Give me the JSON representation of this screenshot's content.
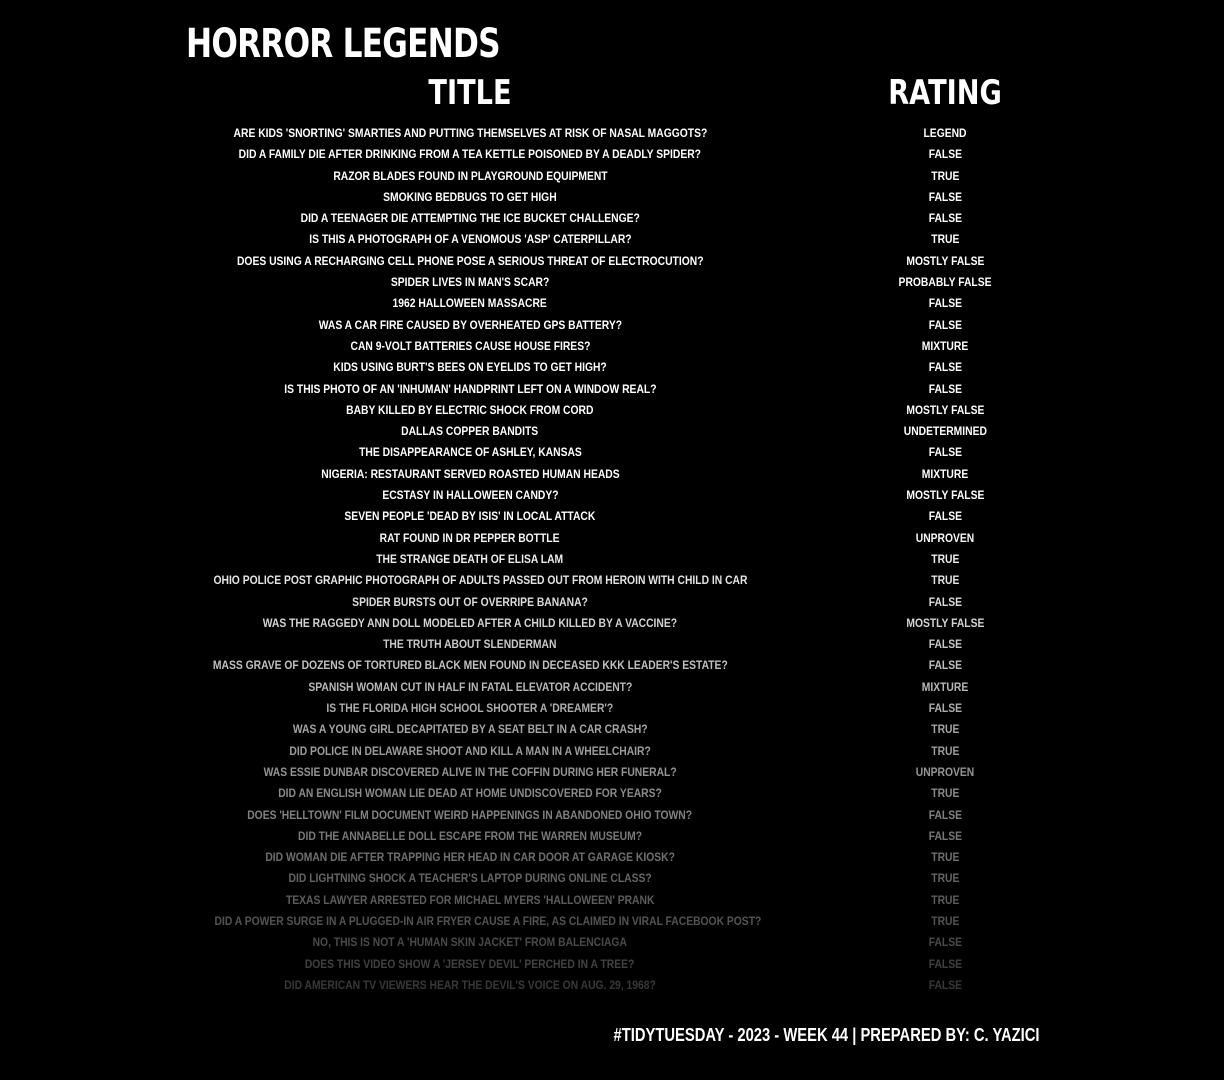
{
  "title": "HORROR LEGENDS",
  "columns": {
    "title": "TITLE",
    "rating": "RATING"
  },
  "rows": [
    {
      "title": "Are kids 'snorting' Smarties and putting themselves at risk of nasal maggots?",
      "rating": "Legend"
    },
    {
      "title": "Did a family die after drinking from a tea kettle poisoned by a deadly spider?",
      "rating": "False"
    },
    {
      "title": "Razor Blades Found in Playground Equipment",
      "rating": "True"
    },
    {
      "title": "Smoking Bedbugs to Get High",
      "rating": "False"
    },
    {
      "title": "Did a Teenager Die Attempting the Ice Bucket Challenge?",
      "rating": "False"
    },
    {
      "title": "Is This a Photograph of a Venomous 'Asp' Caterpillar?",
      "rating": "True"
    },
    {
      "title": "Does Using a Recharging Cell Phone Pose a Serious Threat of Electrocution?",
      "rating": "Mostly False"
    },
    {
      "title": "Spider Lives in Man's Scar?",
      "rating": "Probably False"
    },
    {
      "title": "1962 Halloween Massacre",
      "rating": "False"
    },
    {
      "title": "Was a Car Fire Caused by Overheated GPS Battery?",
      "rating": "False"
    },
    {
      "title": "Can 9-Volt Batteries Cause House Fires?",
      "rating": "Mixture"
    },
    {
      "title": "Kids Using Burt's Bees on Eyelids to Get High?",
      "rating": "False"
    },
    {
      "title": "Is This Photo of an 'Inhuman' Handprint Left on a Window Real?",
      "rating": "False"
    },
    {
      "title": "Baby Killed by Electric Shock from Cord",
      "rating": "Mostly False"
    },
    {
      "title": "Dallas Copper Bandits",
      "rating": "Undetermined"
    },
    {
      "title": "The Disappearance of Ashley, Kansas",
      "rating": "False"
    },
    {
      "title": "Nigeria: Restaurant Served Roasted Human Heads",
      "rating": "Mixture"
    },
    {
      "title": "Ecstasy in Halloween Candy?",
      "rating": "Mostly False"
    },
    {
      "title": "Seven People 'Dead by ISIS' in Local Attack",
      "rating": "False"
    },
    {
      "title": "Rat Found in Dr Pepper Bottle",
      "rating": "Unproven"
    },
    {
      "title": "The Strange Death of Elisa Lam",
      "rating": "True"
    },
    {
      "title": "Ohio Police Post Graphic Photograph of Adults Passed Out from Heroin with Child in Car",
      "rating": "True"
    },
    {
      "title": "Spider Bursts Out of Overripe Banana?",
      "rating": "False"
    },
    {
      "title": "Was the Raggedy Ann Doll Modeled After a Child Killed by a Vaccine?",
      "rating": "Mostly False"
    },
    {
      "title": "The Truth About Slenderman",
      "rating": "False"
    },
    {
      "title": "Mass Grave of Dozens of Tortured Black Men Found in Deceased KKK Leader's Estate?",
      "rating": "False"
    },
    {
      "title": "Spanish Woman Cut in Half in Fatal Elevator Accident?",
      "rating": "Mixture"
    },
    {
      "title": "Is the Florida High School Shooter a 'Dreamer'?",
      "rating": "False"
    },
    {
      "title": "Was a Young Girl Decapitated by a Seat Belt in a Car Crash?",
      "rating": "True"
    },
    {
      "title": "Did Police in Delaware Shoot and Kill a Man in a Wheelchair?",
      "rating": "True"
    },
    {
      "title": "Was Essie Dunbar Discovered Alive in the Coffin During Her Funeral?",
      "rating": "Unproven"
    },
    {
      "title": "Did an English Woman Lie Dead at Home Undiscovered for Years?",
      "rating": "True"
    },
    {
      "title": "Does 'Helltown' Film Document Weird Happenings in Abandoned Ohio Town?",
      "rating": "False"
    },
    {
      "title": "Did the Annabelle Doll Escape from the Warren Museum?",
      "rating": "False"
    },
    {
      "title": "Did Woman Die After Trapping Her Head in Car Door at Garage Kiosk?",
      "rating": "True"
    },
    {
      "title": "Did Lightning Shock a Teacher's Laptop During Online Class?",
      "rating": "True"
    },
    {
      "title": "Texas Lawyer Arrested for Michael Myers 'Halloween' Prank",
      "rating": "True"
    },
    {
      "title": "Did a Power Surge in a Plugged-In Air Fryer Cause a Fire, as Claimed in Viral Facebook Post?",
      "rating": "True"
    },
    {
      "title": "No, This Is Not a 'Human Skin Jacket' from Balenciaga",
      "rating": "False"
    },
    {
      "title": "Does This Video Show a 'Jersey Devil' Perched in a Tree?",
      "rating": "False"
    },
    {
      "title": "Did American TV Viewers Hear the Devil's Voice on Aug. 29, 1968?",
      "rating": "False"
    }
  ],
  "caption": "#TidyTuesday - 2023 - Week 44 | Prepared by: C. YAZICI",
  "colors": {
    "background": "#000000",
    "text": "#ffffff"
  }
}
